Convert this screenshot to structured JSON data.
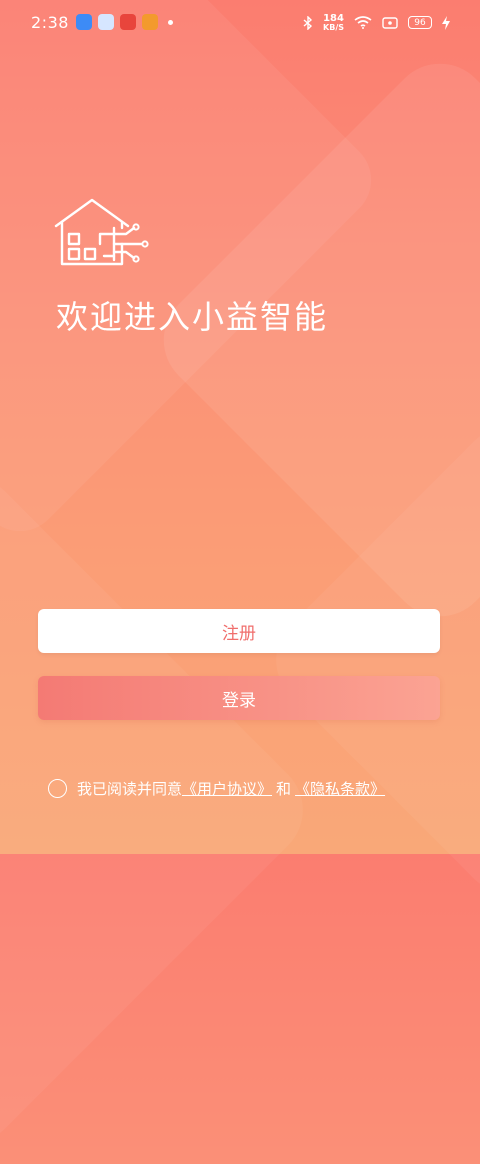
{
  "status_bar": {
    "time": "2:38",
    "net_speed_value": "184",
    "net_speed_unit": "KB/S",
    "battery": "96"
  },
  "welcome_title": "欢迎进入小益智能",
  "buttons": {
    "register": "注册",
    "login": "登录"
  },
  "agreement": {
    "prefix": "我已阅读并同意",
    "user_agreement": "《用户协议》",
    "connector": "和",
    "privacy_policy": "《隐私条款》"
  },
  "colors": {
    "gradient_top": "#fb7d70",
    "gradient_bottom": "#f9a878",
    "register_text": "#f06e6c"
  }
}
